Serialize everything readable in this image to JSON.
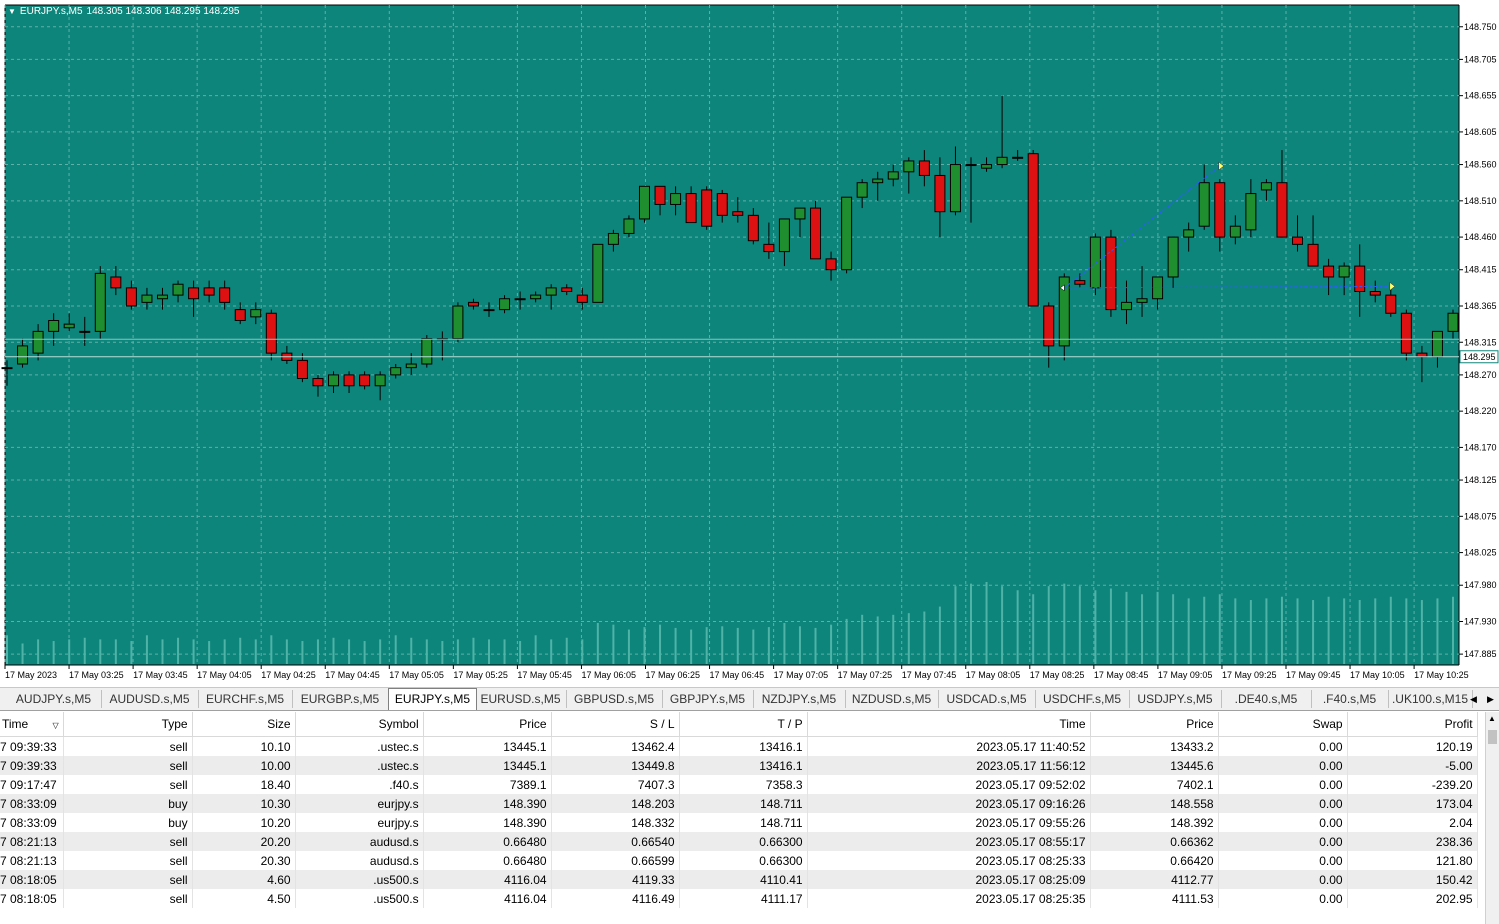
{
  "chart": {
    "header_symbol": "EURJPY.s,M5",
    "header_ohlc": "148.305 148.306 148.295 148.295",
    "bid_label": "148.295",
    "bid_label_hidden": "148.315",
    "price_ticks": [
      "148.750",
      "148.705",
      "148.655",
      "148.605",
      "148.560",
      "148.510",
      "148.460",
      "148.415",
      "148.365",
      "148.315",
      "148.270",
      "148.220",
      "148.170",
      "148.125",
      "148.075",
      "148.025",
      "147.980",
      "147.930",
      "147.885"
    ],
    "time_ticks": [
      "17 May 2023",
      "17 May 03:25",
      "17 May 03:45",
      "17 May 04:05",
      "17 May 04:25",
      "17 May 04:45",
      "17 May 05:05",
      "17 May 05:25",
      "17 May 05:45",
      "17 May 06:05",
      "17 May 06:25",
      "17 May 06:45",
      "17 May 07:05",
      "17 May 07:25",
      "17 May 07:45",
      "17 May 08:05",
      "17 May 08:25",
      "17 May 08:45",
      "17 May 09:05",
      "17 May 09:25",
      "17 May 09:45",
      "17 May 10:05",
      "17 May 10:25"
    ],
    "colors": {
      "background": "#0e857b",
      "up": "#1e8e2e",
      "down": "#dd1111",
      "grid": "#5fb0a8",
      "trade_line": "#2a5cff",
      "bid_line": "#b8dcd8"
    }
  },
  "chart_data": {
    "type": "candlestick",
    "title": "EURJPY.s,M5",
    "xlabel": "",
    "ylabel": "",
    "ylim": [
      147.87,
      148.78
    ],
    "bar_count": 91,
    "candles": [
      [
        148.28,
        148.29,
        148.255,
        148.28
      ],
      [
        148.285,
        148.32,
        148.28,
        148.31
      ],
      [
        148.3,
        148.34,
        148.29,
        148.33
      ],
      [
        148.33,
        148.355,
        148.31,
        148.345
      ],
      [
        148.335,
        148.355,
        148.33,
        148.34
      ],
      [
        148.33,
        148.35,
        148.31,
        148.33
      ],
      [
        148.33,
        148.42,
        148.32,
        148.41
      ],
      [
        148.405,
        148.42,
        148.38,
        148.39
      ],
      [
        148.39,
        148.4,
        148.36,
        148.365
      ],
      [
        148.37,
        148.39,
        148.36,
        148.38
      ],
      [
        148.375,
        148.39,
        148.36,
        148.38
      ],
      [
        148.38,
        148.4,
        148.37,
        148.395
      ],
      [
        148.39,
        148.4,
        148.35,
        148.375
      ],
      [
        148.39,
        148.4,
        148.37,
        148.38
      ],
      [
        148.39,
        148.4,
        148.36,
        148.37
      ],
      [
        148.36,
        148.37,
        148.34,
        148.345
      ],
      [
        148.35,
        148.37,
        148.34,
        148.36
      ],
      [
        148.355,
        148.36,
        148.29,
        148.3
      ],
      [
        148.3,
        148.31,
        148.285,
        148.29
      ],
      [
        148.29,
        148.3,
        148.26,
        148.265
      ],
      [
        148.265,
        148.27,
        148.24,
        148.255
      ],
      [
        148.255,
        148.275,
        148.245,
        148.27
      ],
      [
        148.27,
        148.275,
        148.245,
        148.255
      ],
      [
        148.27,
        148.275,
        148.25,
        148.255
      ],
      [
        148.255,
        148.275,
        148.235,
        148.27
      ],
      [
        148.27,
        148.285,
        148.265,
        148.28
      ],
      [
        148.28,
        148.3,
        148.27,
        148.285
      ],
      [
        148.285,
        148.325,
        148.28,
        148.32
      ],
      [
        148.32,
        148.33,
        148.29,
        148.32
      ],
      [
        148.32,
        148.37,
        148.315,
        148.365
      ],
      [
        148.37,
        148.375,
        148.36,
        148.365
      ],
      [
        148.36,
        148.37,
        148.35,
        148.36
      ],
      [
        148.36,
        148.38,
        148.355,
        148.375
      ],
      [
        148.375,
        148.385,
        148.36,
        148.375
      ],
      [
        148.375,
        148.385,
        148.37,
        148.38
      ],
      [
        148.38,
        148.395,
        148.36,
        148.39
      ],
      [
        148.39,
        148.395,
        148.38,
        148.385
      ],
      [
        148.38,
        148.39,
        148.36,
        148.37
      ],
      [
        148.37,
        148.45,
        148.37,
        148.45
      ],
      [
        148.45,
        148.47,
        148.44,
        148.465
      ],
      [
        148.465,
        148.49,
        148.46,
        148.485
      ],
      [
        148.485,
        148.53,
        148.48,
        148.53
      ],
      [
        148.53,
        148.53,
        148.49,
        148.505
      ],
      [
        148.505,
        148.53,
        148.49,
        148.52
      ],
      [
        148.52,
        148.53,
        148.48,
        148.48
      ],
      [
        148.525,
        148.53,
        148.47,
        148.475
      ],
      [
        148.52,
        148.525,
        148.48,
        148.49
      ],
      [
        148.495,
        148.515,
        148.48,
        148.49
      ],
      [
        148.49,
        148.5,
        148.45,
        148.455
      ],
      [
        148.45,
        148.48,
        148.43,
        148.44
      ],
      [
        148.44,
        148.48,
        148.42,
        148.485
      ],
      [
        148.485,
        148.5,
        148.46,
        148.5
      ],
      [
        148.5,
        148.51,
        148.43,
        148.43
      ],
      [
        148.43,
        148.44,
        148.4,
        148.415
      ],
      [
        148.415,
        148.515,
        148.41,
        148.515
      ],
      [
        148.515,
        148.54,
        148.5,
        148.535
      ],
      [
        148.535,
        148.55,
        148.51,
        148.54
      ],
      [
        148.54,
        148.56,
        148.53,
        148.55
      ],
      [
        148.55,
        148.57,
        148.52,
        148.565
      ],
      [
        148.565,
        148.58,
        148.53,
        148.545
      ],
      [
        148.545,
        148.57,
        148.46,
        148.495
      ],
      [
        148.495,
        148.585,
        148.49,
        148.56
      ],
      [
        148.56,
        148.57,
        148.48,
        148.56
      ],
      [
        148.555,
        148.57,
        148.55,
        148.56
      ],
      [
        148.56,
        148.655,
        148.555,
        148.57
      ],
      [
        148.57,
        148.58,
        148.565,
        148.57
      ],
      [
        148.575,
        148.58,
        148.365,
        148.365
      ],
      [
        148.365,
        148.37,
        148.28,
        148.31
      ],
      [
        148.31,
        148.41,
        148.29,
        148.405
      ],
      [
        148.4,
        148.41,
        148.39,
        148.395
      ],
      [
        148.39,
        148.465,
        148.38,
        148.46
      ],
      [
        148.46,
        148.47,
        148.35,
        148.36
      ],
      [
        148.36,
        148.4,
        148.34,
        148.37
      ],
      [
        148.37,
        148.42,
        148.35,
        148.375
      ],
      [
        148.375,
        148.4,
        148.36,
        148.405
      ],
      [
        148.405,
        148.46,
        148.39,
        148.46
      ],
      [
        148.46,
        148.48,
        148.44,
        148.47
      ],
      [
        148.475,
        148.56,
        148.47,
        148.535
      ],
      [
        148.535,
        148.54,
        148.44,
        148.46
      ],
      [
        148.46,
        148.49,
        148.45,
        148.475
      ],
      [
        148.47,
        148.54,
        148.46,
        148.52
      ],
      [
        148.525,
        148.54,
        148.51,
        148.535
      ],
      [
        148.535,
        148.58,
        148.46,
        148.46
      ],
      [
        148.46,
        148.49,
        148.44,
        148.45
      ],
      [
        148.45,
        148.49,
        148.42,
        148.42
      ],
      [
        148.42,
        148.43,
        148.38,
        148.405
      ],
      [
        148.405,
        148.425,
        148.38,
        148.42
      ],
      [
        148.42,
        148.45,
        148.35,
        148.385
      ],
      [
        148.385,
        148.4,
        148.37,
        148.38
      ],
      [
        148.38,
        148.39,
        148.35,
        148.355
      ],
      [
        148.355,
        148.36,
        148.29,
        148.3
      ],
      [
        148.3,
        148.31,
        148.26,
        148.295
      ],
      [
        148.295,
        148.33,
        148.28,
        148.33
      ],
      [
        148.33,
        148.36,
        148.32,
        148.355
      ]
    ],
    "volumes": [
      0.35,
      0.25,
      0.3,
      0.28,
      0.3,
      0.32,
      0.3,
      0.3,
      0.28,
      0.35,
      0.3,
      0.32,
      0.3,
      0.28,
      0.3,
      0.32,
      0.3,
      0.35,
      0.3,
      0.28,
      0.3,
      0.32,
      0.3,
      0.28,
      0.3,
      0.35,
      0.32,
      0.3,
      0.28,
      0.3,
      0.32,
      0.3,
      0.3,
      0.28,
      0.35,
      0.3,
      0.32,
      0.3,
      0.5,
      0.48,
      0.42,
      0.45,
      0.48,
      0.44,
      0.42,
      0.45,
      0.46,
      0.44,
      0.42,
      0.45,
      0.5,
      0.46,
      0.44,
      0.48,
      0.55,
      0.6,
      0.58,
      0.6,
      0.62,
      0.64,
      0.7,
      0.95,
      0.98,
      1.0,
      0.95,
      0.9,
      0.85,
      0.95,
      0.98,
      0.95,
      0.9,
      0.92,
      0.88,
      0.85,
      0.88,
      0.85,
      0.8,
      0.82,
      0.85,
      0.8,
      0.78,
      0.8,
      0.82,
      0.8,
      0.78,
      0.82,
      0.8,
      0.78,
      0.8,
      0.82,
      0.8,
      0.78,
      0.8,
      0.82
    ]
  },
  "tabs": [
    "AUDJPY.s,M5",
    "AUDUSD.s,M5",
    "EURCHF.s,M5",
    "EURGBP.s,M5",
    "EURJPY.s,M5",
    "EURUSD.s,M5",
    "GBPUSD.s,M5",
    "GBPJPY.s,M5",
    "NZDJPY.s,M5",
    "NZDUSD.s,M5",
    "USDCAD.s,M5",
    "USDCHF.s,M5",
    "USDJPY.s,M5",
    ".DE40.s,M5",
    ".F40.s,M5",
    ".UK100.s,M15"
  ],
  "active_tab": "EURJPY.s,M5",
  "table": {
    "columns": [
      "Time",
      "Type",
      "Size",
      "Symbol",
      "Price",
      "S / L",
      "T / P",
      "Time",
      "Price",
      "Swap",
      "Profit"
    ],
    "rows": [
      [
        "7 09:39:33",
        "sell",
        "10.10",
        ".ustec.s",
        "13445.1",
        "13462.4",
        "13416.1",
        "2023.05.17 11:40:52",
        "13433.2",
        "0.00",
        "120.19"
      ],
      [
        "7 09:39:33",
        "sell",
        "10.00",
        ".ustec.s",
        "13445.1",
        "13449.8",
        "13416.1",
        "2023.05.17 11:56:12",
        "13445.6",
        "0.00",
        "-5.00"
      ],
      [
        "7 09:17:47",
        "sell",
        "18.40",
        ".f40.s",
        "7389.1",
        "7407.3",
        "7358.3",
        "2023.05.17 09:52:02",
        "7402.1",
        "0.00",
        "-239.20"
      ],
      [
        "7 08:33:09",
        "buy",
        "10.30",
        "eurjpy.s",
        "148.390",
        "148.203",
        "148.711",
        "2023.05.17 09:16:26",
        "148.558",
        "0.00",
        "173.04"
      ],
      [
        "7 08:33:09",
        "buy",
        "10.20",
        "eurjpy.s",
        "148.390",
        "148.332",
        "148.711",
        "2023.05.17 09:55:26",
        "148.392",
        "0.00",
        "2.04"
      ],
      [
        "7 08:21:13",
        "sell",
        "20.20",
        "audusd.s",
        "0.66480",
        "0.66540",
        "0.66300",
        "2023.05.17 08:55:17",
        "0.66362",
        "0.00",
        "238.36"
      ],
      [
        "7 08:21:13",
        "sell",
        "20.30",
        "audusd.s",
        "0.66480",
        "0.66599",
        "0.66300",
        "2023.05.17 08:25:33",
        "0.66420",
        "0.00",
        "121.80"
      ],
      [
        "7 08:18:05",
        "sell",
        "4.60",
        ".us500.s",
        "4116.04",
        "4119.33",
        "4110.41",
        "2023.05.17 08:25:09",
        "4112.77",
        "0.00",
        "150.42"
      ],
      [
        "7 08:18:05",
        "sell",
        "4.50",
        ".us500.s",
        "4116.04",
        "4116.49",
        "4111.17",
        "2023.05.17 08:25:35",
        "4111.53",
        "0.00",
        "202.95"
      ]
    ]
  }
}
